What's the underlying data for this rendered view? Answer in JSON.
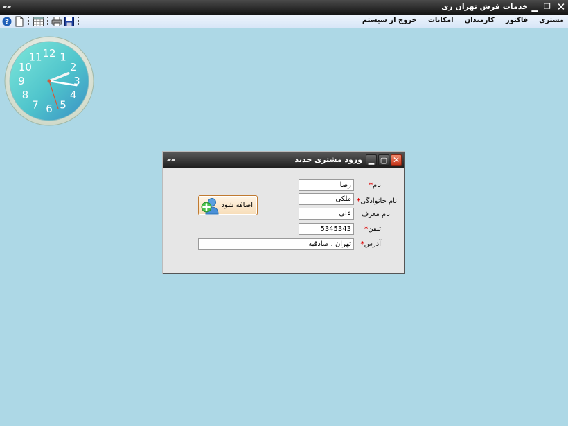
{
  "window": {
    "title": "خدمات فرش تهران ری",
    "app_icon": "app-icon",
    "close_icon": "close-icon",
    "restore_icon": "restore-icon",
    "minimize_icon": "minimize-icon"
  },
  "toolbar": {
    "items": [
      "help-icon",
      "new-document-icon",
      "grid-icon",
      "print-icon",
      "save-icon"
    ]
  },
  "menu": {
    "items": [
      {
        "label": "مشتری"
      },
      {
        "label": "فاکتور"
      },
      {
        "label": "کارمندان"
      },
      {
        "label": "امکانات"
      },
      {
        "label": "خروج از سیستم"
      }
    ]
  },
  "clock": {
    "numerals": [
      "12",
      "1",
      "2",
      "3",
      "4",
      "5",
      "6",
      "7",
      "8",
      "9",
      "10",
      "11"
    ],
    "hour": 2,
    "minute": 16,
    "second": 27
  },
  "dialog": {
    "title": "ورود مشتری جدید",
    "fields": {
      "first_name": {
        "label": "نام",
        "value": "رضا"
      },
      "last_name": {
        "label": "نام خانوادگی",
        "value": "ملکی"
      },
      "referrer": {
        "label": "نام معرف",
        "value": "علی"
      },
      "phone": {
        "label": "تلفن",
        "value": "5345343"
      },
      "address": {
        "label": "آدرس",
        "value": "تهران ، صادقیه"
      }
    },
    "required_marker": "*",
    "add_button": {
      "label": "اضافه شود"
    }
  },
  "colors": {
    "desktop": "#add8e6",
    "menubar": "#dbe8f8",
    "dialog_bg": "#e6e6e6",
    "required": "#dd0000",
    "button_border": "#c07a30",
    "clock_face": "#5ecfd0"
  }
}
